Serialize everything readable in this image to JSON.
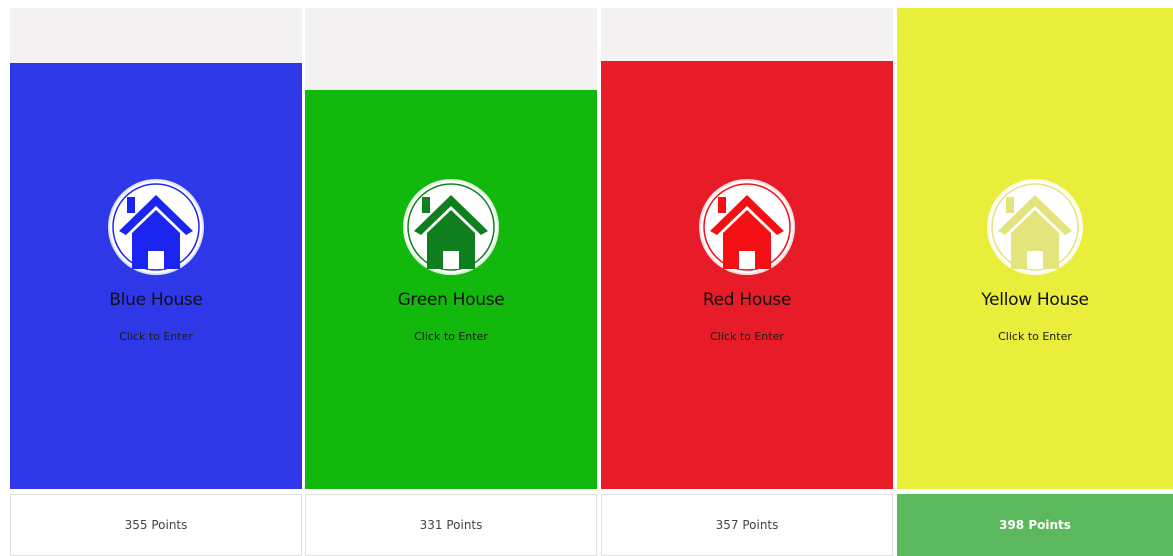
{
  "houses": [
    {
      "name": "Blue House",
      "cta": "Click to Enter",
      "points": "355 Points",
      "points_value": 355,
      "color": "#2f38e8",
      "icon_color": "#1a25f0",
      "icon": "house-icon",
      "winner": false
    },
    {
      "name": "Green House",
      "cta": "Click to Enter",
      "points": "331 Points",
      "points_value": 331,
      "color": "#12b90c",
      "icon_color": "#0f7f1d",
      "icon": "house-icon",
      "winner": false
    },
    {
      "name": "Red House",
      "cta": "Click to Enter",
      "points": "357 Points",
      "points_value": 357,
      "color": "#e81c29",
      "icon_color": "#f40f14",
      "icon": "house-icon",
      "winner": false
    },
    {
      "name": "Yellow House",
      "cta": "Click to Enter",
      "points": "398 Points",
      "points_value": 398,
      "color": "#e8ee3a",
      "icon_color": "#e3e47c",
      "icon": "house-icon",
      "winner": true
    }
  ],
  "winner_color": "#5cb85c"
}
